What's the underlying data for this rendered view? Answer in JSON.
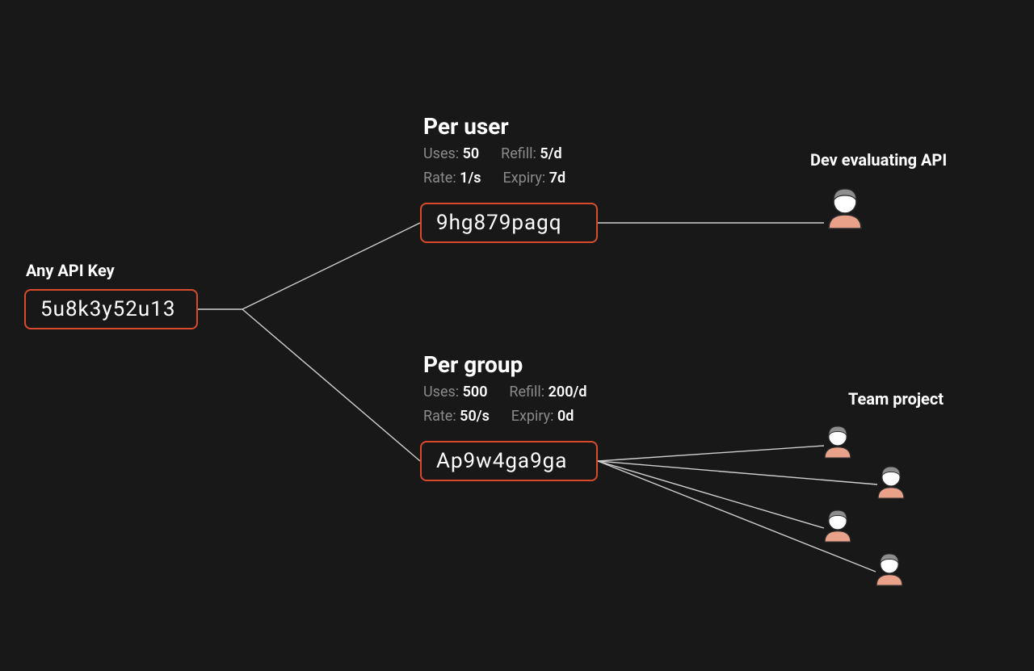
{
  "root": {
    "title": "Any API Key",
    "key": "5u8k3y52u13"
  },
  "per_user": {
    "title": "Per user",
    "uses_label": "Uses:",
    "uses_value": "50",
    "refill_label": "Refill:",
    "refill_value": "5/d",
    "rate_label": "Rate:",
    "rate_value": "1/s",
    "expiry_label": "Expiry:",
    "expiry_value": "7d",
    "key": "9hg879pagq",
    "audience": "Dev evaluating API"
  },
  "per_group": {
    "title": "Per group",
    "uses_label": "Uses:",
    "uses_value": "500",
    "refill_label": "Refill:",
    "refill_value": "200/d",
    "rate_label": "Rate:",
    "rate_value": "50/s",
    "expiry_label": "Expiry:",
    "expiry_value": "0d",
    "key": "Ap9w4ga9ga",
    "audience": "Team project"
  },
  "colors": {
    "accent": "#d84a2b",
    "muted": "#8a8a8a",
    "bg": "#181818"
  }
}
